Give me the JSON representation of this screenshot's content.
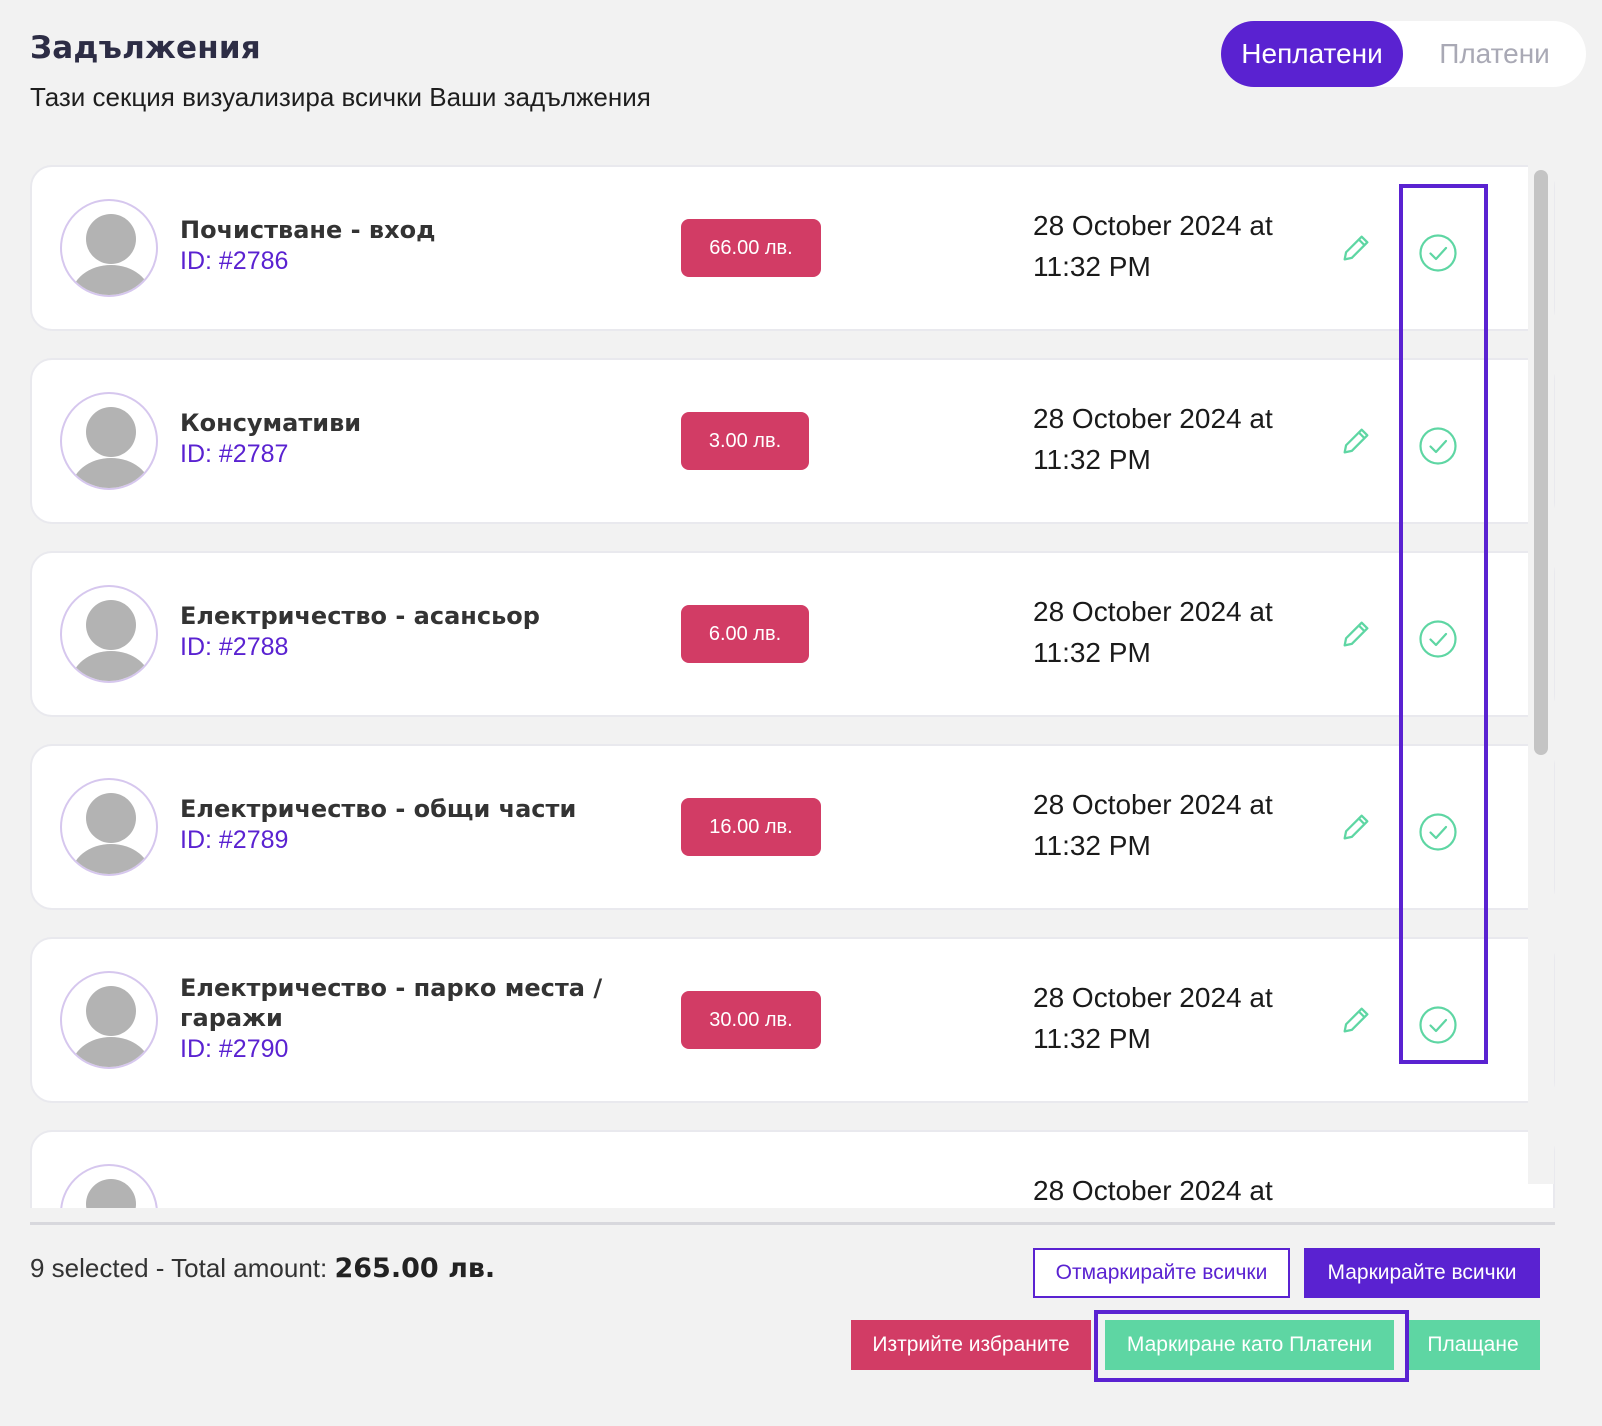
{
  "header": {
    "title": "Задължения",
    "subtitle": "Тази секция визуализира всички Ваши задължения"
  },
  "tabs": [
    {
      "label": "Неплатени",
      "active": true
    },
    {
      "label": "Платени",
      "active": false
    }
  ],
  "debts": [
    {
      "name": "Почистване - вход",
      "id": "ID: #2786",
      "amount": "66.00 лв.",
      "date_line1": "28 October 2024 at",
      "date_line2": "11:32 PM"
    },
    {
      "name": "Консумативи",
      "id": "ID: #2787",
      "amount": "3.00 лв.",
      "date_line1": "28 October 2024 at",
      "date_line2": "11:32 PM"
    },
    {
      "name": "Електричество - асансьор",
      "id": "ID: #2788",
      "amount": "6.00 лв.",
      "date_line1": "28 October 2024 at",
      "date_line2": "11:32 PM"
    },
    {
      "name": "Електричество - общи части",
      "id": "ID: #2789",
      "amount": "16.00 лв.",
      "date_line1": "28 October 2024 at",
      "date_line2": "11:32 PM"
    },
    {
      "name": "Електричество - парко места / гаражи",
      "id": "ID: #2790",
      "amount": "30.00 лв.",
      "date_line1": "28 October 2024 at",
      "date_line2": "11:32 PM"
    },
    {
      "name": "",
      "id": "",
      "amount": "",
      "date_line1": "28 October 2024 at",
      "date_line2": ""
    }
  ],
  "summary": {
    "selected_text": "9 selected - Total amount:",
    "total": "265.00 лв."
  },
  "actions": {
    "unmark_all": "Отмаркирайте всички",
    "mark_all": "Маркирайте всички",
    "delete_selected": "Изтрийте избраните",
    "mark_paid": "Маркиране като Платени",
    "pay": "Плащане"
  },
  "colors": {
    "accent": "#5a22d1",
    "amount_badge": "#d23c65",
    "success": "#5ed6a3",
    "background": "#f2f2f2"
  },
  "icons": {
    "edit": "pencil-icon",
    "mark_paid": "check-circle-icon",
    "avatar": "user-avatar-icon"
  }
}
